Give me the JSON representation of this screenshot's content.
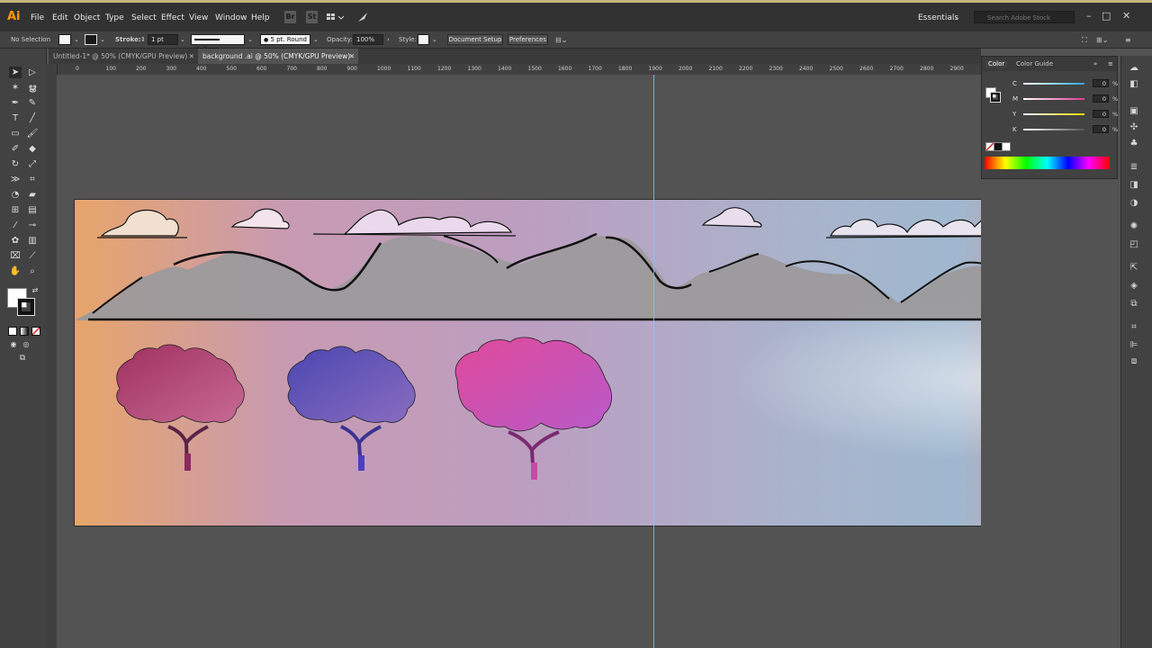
{
  "app": {
    "logo": "Ai",
    "accent": "#ff9a00"
  },
  "menu": [
    "File",
    "Edit",
    "Object",
    "Type",
    "Select",
    "Effect",
    "View",
    "Window",
    "Help"
  ],
  "menubar_icons": [
    "Br",
    "St"
  ],
  "workspace": {
    "label": "Essentials",
    "search_placeholder": "Search Adobe Stock"
  },
  "controlbar": {
    "selection": "No Selection",
    "stroke_label": "Stroke:",
    "stroke_value": "1 pt",
    "profile": "Uniform",
    "brush": "5 pt. Round",
    "opacity_label": "Opacity:",
    "opacity_value": "100%",
    "style_label": "Style:",
    "document_setup": "Document Setup",
    "preferences": "Preferences"
  },
  "tabs": [
    {
      "label": "Untitled-1* @ 50% (CMYK/GPU Preview)",
      "active": false
    },
    {
      "label": "background .ai @ 50% (CMYK/GPU Preview)",
      "active": true
    }
  ],
  "ruler_labels": [
    "0",
    "100",
    "200",
    "300",
    "400",
    "500",
    "600",
    "700",
    "800",
    "900",
    "1000",
    "1100",
    "1200",
    "1300",
    "1400",
    "1500",
    "1600",
    "1700",
    "1800",
    "1900",
    "2000",
    "2100",
    "2200",
    "2300",
    "2400",
    "2500",
    "2600",
    "2700",
    "2800",
    "2900"
  ],
  "color_panel": {
    "tabs": [
      "Color",
      "Color Guide"
    ],
    "sliders": [
      {
        "label": "C",
        "value": "0",
        "color": "#2aa7df"
      },
      {
        "label": "M",
        "value": "0",
        "color": "#e1368e"
      },
      {
        "label": "Y",
        "value": "0",
        "color": "#f4e400"
      },
      {
        "label": "K",
        "value": "0",
        "color": "#555555"
      }
    ],
    "unit": "%"
  }
}
